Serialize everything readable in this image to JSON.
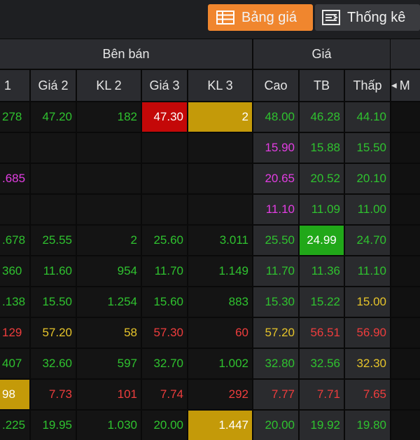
{
  "tabs": [
    {
      "label": "Bảng giá",
      "icon": "table-icon",
      "active": true
    },
    {
      "label": "Thống kê",
      "icon": "statistics-icon",
      "active": false
    }
  ],
  "groups": {
    "seller": "Bên bán",
    "price": "Giá"
  },
  "headers": [
    "1",
    "Giá 2",
    "KL 2",
    "Giá 3",
    "KL 3",
    "Cao",
    "TB",
    "Thấp",
    "M"
  ],
  "colors": {
    "green": "#2fc22f",
    "magenta": "#e23de2",
    "red": "#ee3d3d",
    "yellow": "#e6c42a",
    "white": "#ffffff",
    "highlight_red_bg": "#c40808",
    "highlight_gold_bg": "#c49a09",
    "highlight_green_bg": "#21a819"
  },
  "rows": [
    [
      "278",
      "47.20",
      "182",
      "47.30",
      "2",
      "48.00",
      "46.28",
      "44.10"
    ],
    [
      "",
      "",
      "",
      "",
      "",
      "15.90",
      "15.88",
      "15.50"
    ],
    [
      ".685",
      "",
      "",
      "",
      "",
      "20.65",
      "20.52",
      "20.10"
    ],
    [
      "",
      "",
      "",
      "",
      "",
      "11.10",
      "11.09",
      "11.00"
    ],
    [
      ".678",
      "25.55",
      "2",
      "25.60",
      "3.011",
      "25.50",
      "24.99",
      "24.70"
    ],
    [
      "360",
      "11.60",
      "954",
      "11.70",
      "1.149",
      "11.70",
      "11.36",
      "11.10"
    ],
    [
      ".138",
      "15.50",
      "1.254",
      "15.60",
      "883",
      "15.30",
      "15.22",
      "15.00"
    ],
    [
      "129",
      "57.20",
      "58",
      "57.30",
      "60",
      "57.20",
      "56.51",
      "56.90"
    ],
    [
      "407",
      "32.60",
      "597",
      "32.70",
      "1.002",
      "32.80",
      "32.56",
      "32.30"
    ],
    [
      "98",
      "7.73",
      "101",
      "7.74",
      "292",
      "7.77",
      "7.71",
      "7.65"
    ],
    [
      ".225",
      "19.95",
      "1.030",
      "20.00",
      "1.447",
      "20.00",
      "19.92",
      "19.80"
    ]
  ],
  "row_colors": [
    [
      "green",
      "green",
      "green",
      "white",
      "white",
      "green",
      "green",
      "green"
    ],
    [
      "",
      "",
      "",
      "",
      "",
      "magenta",
      "green",
      "green"
    ],
    [
      "magenta",
      "",
      "",
      "",
      "",
      "magenta",
      "green",
      "green"
    ],
    [
      "",
      "",
      "",
      "",
      "",
      "magenta",
      "green",
      "green"
    ],
    [
      "green",
      "green",
      "green",
      "green",
      "green",
      "green",
      "white",
      "green"
    ],
    [
      "green",
      "green",
      "green",
      "green",
      "green",
      "green",
      "green",
      "green"
    ],
    [
      "green",
      "green",
      "green",
      "green",
      "green",
      "green",
      "green",
      "yellow"
    ],
    [
      "red",
      "yellow",
      "yellow",
      "red",
      "red",
      "yellow",
      "red",
      "red"
    ],
    [
      "green",
      "green",
      "green",
      "green",
      "green",
      "green",
      "green",
      "yellow"
    ],
    [
      "white",
      "red",
      "red",
      "red",
      "red",
      "red",
      "red",
      "red"
    ],
    [
      "green",
      "green",
      "green",
      "green",
      "white",
      "green",
      "green",
      "green"
    ]
  ],
  "row_bgs": [
    [
      "",
      "",
      "",
      "highlight_red_bg",
      "highlight_gold_bg",
      "",
      "",
      ""
    ],
    [
      "",
      "",
      "",
      "",
      "",
      "",
      "",
      ""
    ],
    [
      "",
      "",
      "",
      "",
      "",
      "",
      "",
      ""
    ],
    [
      "",
      "",
      "",
      "",
      "",
      "",
      "",
      ""
    ],
    [
      "",
      "",
      "",
      "",
      "",
      "",
      "highlight_green_bg",
      ""
    ],
    [
      "",
      "",
      "",
      "",
      "",
      "",
      "",
      ""
    ],
    [
      "",
      "",
      "",
      "",
      "",
      "",
      "",
      ""
    ],
    [
      "",
      "",
      "",
      "",
      "",
      "",
      "",
      ""
    ],
    [
      "",
      "",
      "",
      "",
      "",
      "",
      "",
      ""
    ],
    [
      "highlight_gold_bg",
      "",
      "",
      "",
      "",
      "",
      "",
      ""
    ],
    [
      "",
      "",
      "",
      "",
      "highlight_gold_bg",
      "",
      "",
      ""
    ]
  ]
}
